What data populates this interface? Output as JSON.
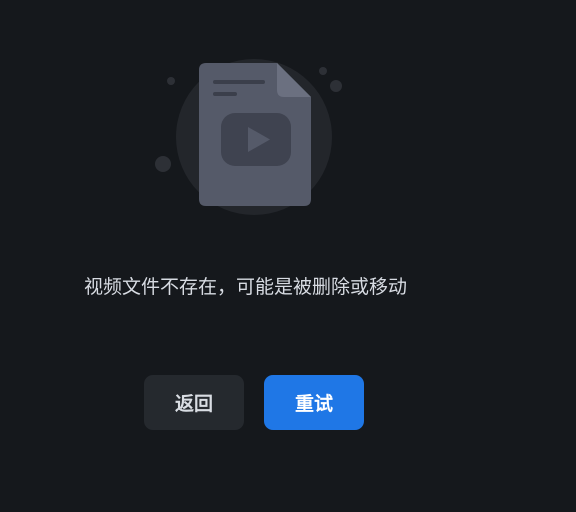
{
  "empty_state": {
    "illustration_icon": "video-file-missing-icon",
    "message": "视频文件不存在，可能是被删除或移动"
  },
  "actions": {
    "back_label": "返回",
    "retry_label": "重试"
  },
  "colors": {
    "background": "#15181c",
    "primary": "#1f77e6",
    "secondary_button": "#25292e",
    "illustration_circle": "#23262b",
    "document": "#555a69"
  }
}
